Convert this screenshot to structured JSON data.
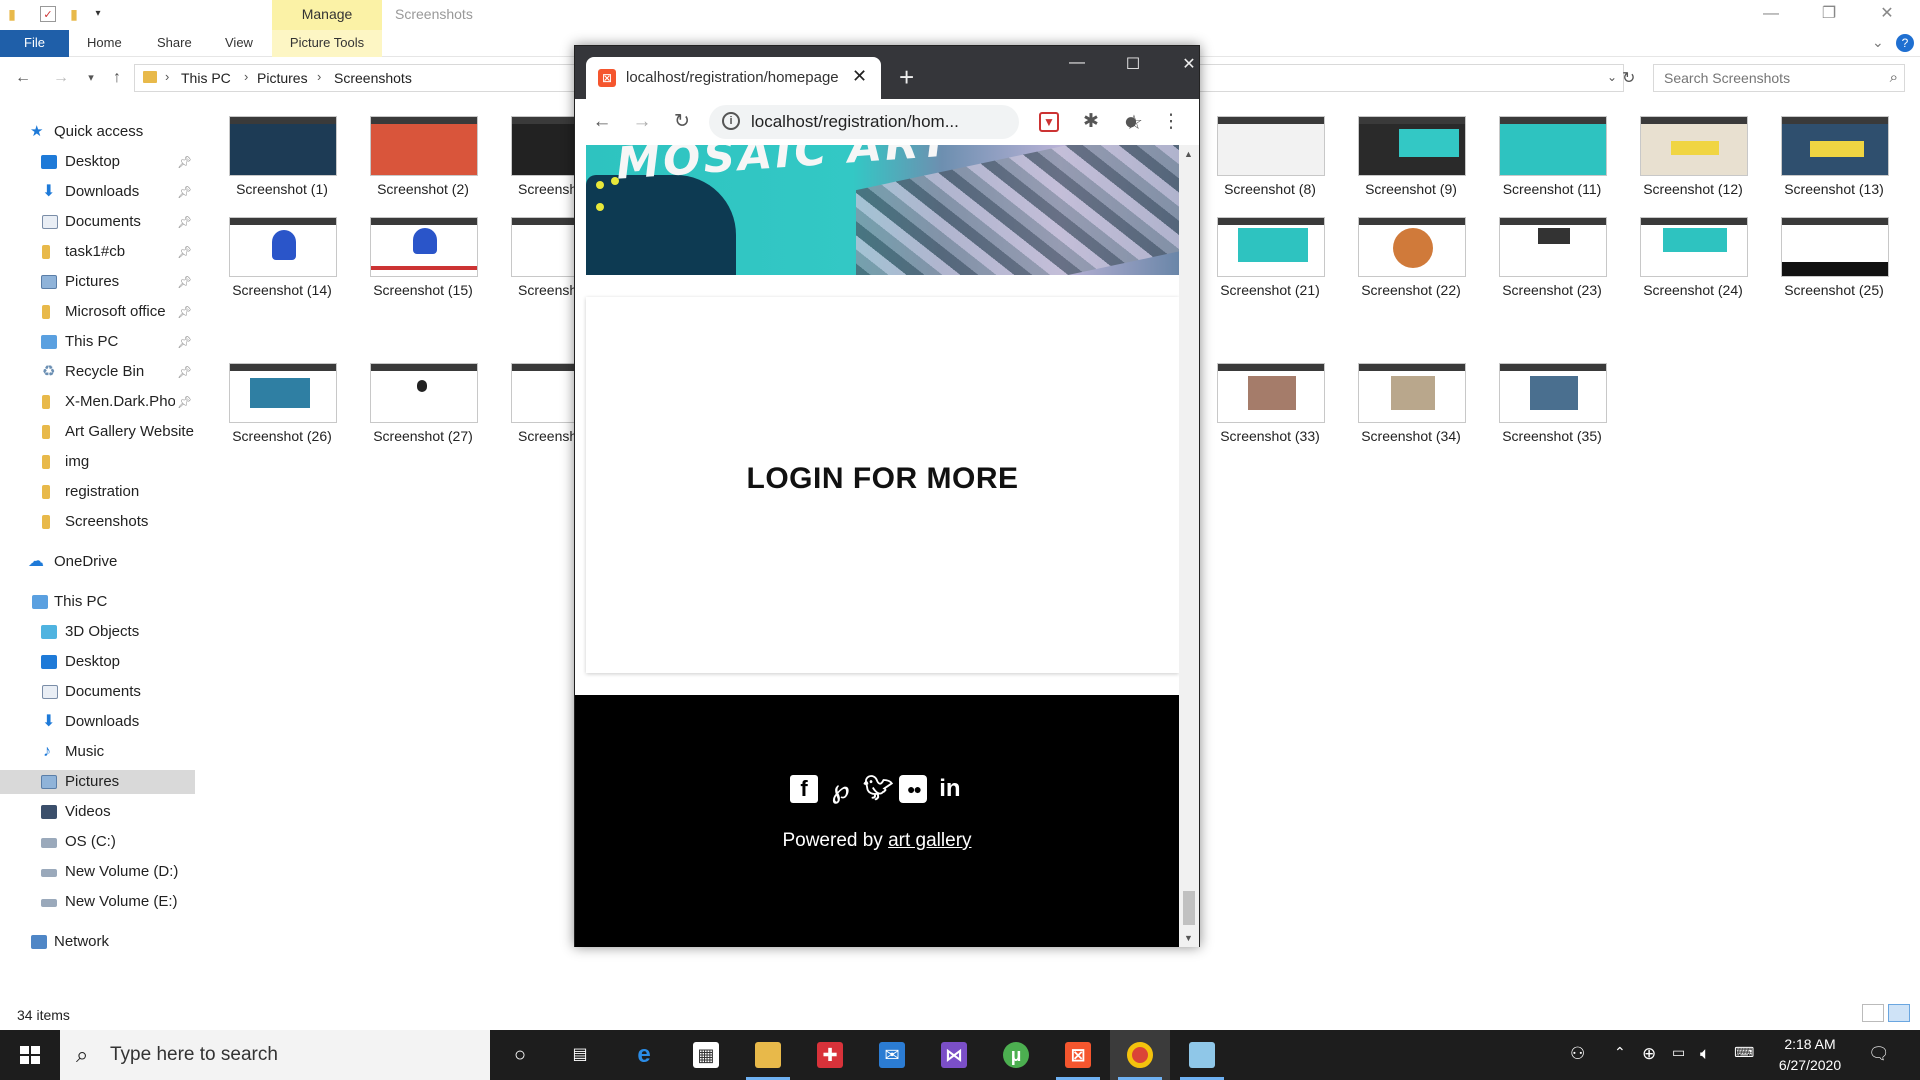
{
  "explorer": {
    "title": "Screenshots",
    "ribbon": {
      "file": "File",
      "home": "Home",
      "share": "Share",
      "view": "View",
      "manage": "Manage",
      "picture_tools": "Picture Tools"
    },
    "breadcrumb": [
      "This PC",
      "Pictures",
      "Screenshots"
    ],
    "search_placeholder": "Search Screenshots",
    "nav": {
      "quick_access": "Quick access",
      "quick_items": [
        "Desktop",
        "Downloads",
        "Documents",
        "task1#cb",
        "Pictures",
        "Microsoft office",
        "This PC",
        "Recycle Bin",
        "X-Men.Dark.Phoe",
        "Art Gallery Website",
        "img",
        "registration",
        "Screenshots"
      ],
      "onedrive": "OneDrive",
      "this_pc": "This PC",
      "pc_items": [
        "3D Objects",
        "Desktop",
        "Documents",
        "Downloads",
        "Music",
        "Pictures",
        "Videos",
        "OS (C:)",
        "New Volume (D:)",
        "New Volume (E:)"
      ],
      "network": "Network"
    },
    "thumbnails": {
      "row1_left": [
        "Screenshot (1)",
        "Screenshot (2)",
        "Screensh"
      ],
      "row1_right": [
        "Screenshot (8)",
        "Screenshot (9)",
        "Screenshot (11)",
        "Screenshot (12)",
        "Screenshot (13)"
      ],
      "row2_left": [
        "Screenshot (14)",
        "Screenshot (15)",
        "Screensh"
      ],
      "row2_right": [
        "Screenshot (21)",
        "Screenshot (22)",
        "Screenshot (23)",
        "Screenshot (24)",
        "Screenshot (25)"
      ],
      "row3_left": [
        "Screenshot (26)",
        "Screenshot (27)",
        "Screensh"
      ],
      "row3_right": [
        "Screenshot (33)",
        "Screenshot (34)",
        "Screenshot (35)"
      ]
    },
    "status": "34 items"
  },
  "chrome": {
    "tab_title": "localhost/registration/homepage",
    "url": "localhost/registration/hom...",
    "page": {
      "banner_text": "MOSAIC ART",
      "login_heading": "LOGIN FOR MORE",
      "powered_prefix": "Powered by",
      "powered_link": "art gallery"
    }
  },
  "taskbar": {
    "search_placeholder": "Type here to search",
    "time": "2:18 AM",
    "date": "6/27/2020"
  },
  "colors": {
    "file_tab": "#1f5fa9",
    "manage_tab": "#fbf2a6",
    "chrome_frame": "#35363a",
    "banner_teal": "#33c8c5",
    "footer": "#000000",
    "taskbar": "#1d1d1d"
  }
}
